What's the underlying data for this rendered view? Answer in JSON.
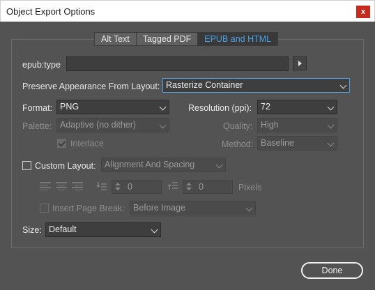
{
  "window": {
    "title": "Object Export Options",
    "close_glyph": "x"
  },
  "tabs": [
    {
      "label": "Alt Text",
      "active": false
    },
    {
      "label": "Tagged PDF",
      "active": false
    },
    {
      "label": "EPUB and HTML",
      "active": true
    }
  ],
  "epub_type": {
    "label": "epub:type",
    "value": ""
  },
  "preserve": {
    "label": "Preserve Appearance From Layout:",
    "value": "Rasterize Container"
  },
  "format": {
    "label": "Format:",
    "value": "PNG"
  },
  "resolution": {
    "label": "Resolution (ppi):",
    "value": "72"
  },
  "palette": {
    "label": "Palette:",
    "value": "Adaptive (no dither)"
  },
  "quality": {
    "label": "Quality:",
    "value": "High"
  },
  "interlace": {
    "label": "Interlace",
    "checked": true
  },
  "method": {
    "label": "Method:",
    "value": "Baseline"
  },
  "custom_layout": {
    "label": "Custom Layout:",
    "checked": false,
    "value": "Alignment And Spacing"
  },
  "spacing": {
    "before": "0",
    "after": "0",
    "unit": "Pixels"
  },
  "page_break": {
    "label": "Insert Page Break:",
    "checked": false,
    "value": "Before Image"
  },
  "size": {
    "label": "Size:",
    "value": "Default"
  },
  "done_label": "Done",
  "colors": {
    "accent": "#4aa3e8",
    "background": "#535353",
    "close": "#c42b1c"
  }
}
